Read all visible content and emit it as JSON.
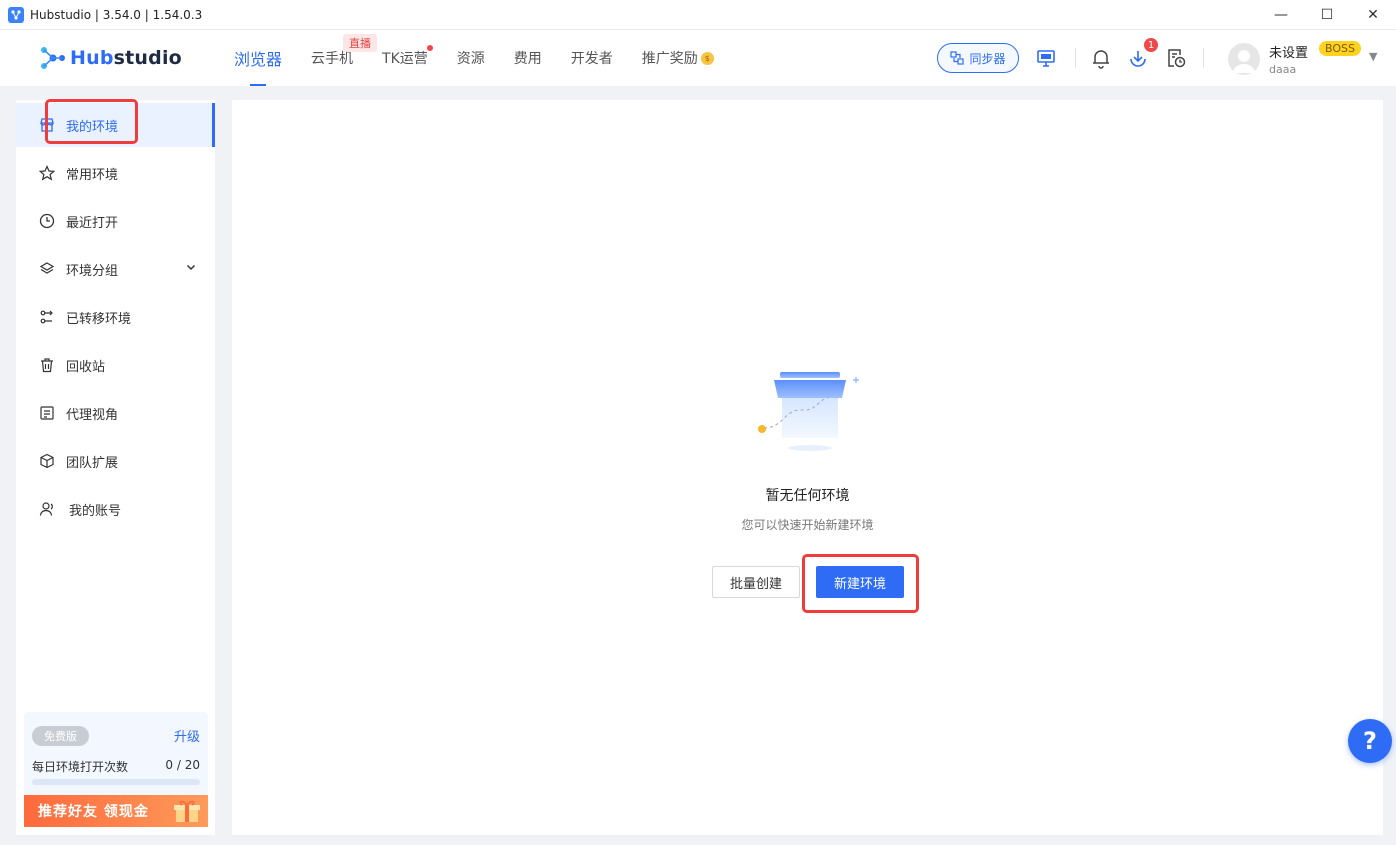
{
  "window": {
    "title": "Hubstudio | 3.54.0 | 1.54.0.3"
  },
  "brand": {
    "logo_hub": "Hub",
    "logo_studio": "studio",
    "accent": "#2e6cf6"
  },
  "nav": {
    "items": [
      {
        "label": "浏览器"
      },
      {
        "label": "云手机",
        "badge": "直播"
      },
      {
        "label": "TK运营"
      },
      {
        "label": "资源"
      },
      {
        "label": "费用"
      },
      {
        "label": "开发者"
      },
      {
        "label": "推广奖励"
      }
    ]
  },
  "header": {
    "sync_label": "同步器",
    "download_badge": "1",
    "user_name": "未设置",
    "user_badge": "BOSS",
    "user_sub": "daaa"
  },
  "sidebar": {
    "items": [
      {
        "label": "我的环境",
        "icon": "store-icon"
      },
      {
        "label": "常用环境",
        "icon": "star-icon"
      },
      {
        "label": "最近打开",
        "icon": "clock-icon"
      },
      {
        "label": "环境分组",
        "icon": "layers-icon"
      },
      {
        "label": "已转移环境",
        "icon": "transfer-icon"
      },
      {
        "label": "回收站",
        "icon": "trash-icon"
      },
      {
        "label": "代理视角",
        "icon": "list-icon"
      },
      {
        "label": "团队扩展",
        "icon": "cube-icon"
      },
      {
        "label": "我的账号",
        "icon": "user-icon"
      }
    ],
    "plan": {
      "tag": "免费版",
      "upgrade": "升级",
      "label": "每日环境打开次数",
      "count": "0 / 20",
      "progress": 0
    },
    "promo": "推荐好友 领现金"
  },
  "main": {
    "empty_title": "暂无任何环境",
    "empty_sub": "您可以快速开始新建环境",
    "batch_button": "批量创建",
    "new_button": "新建环境"
  },
  "help": {
    "label": "?"
  }
}
